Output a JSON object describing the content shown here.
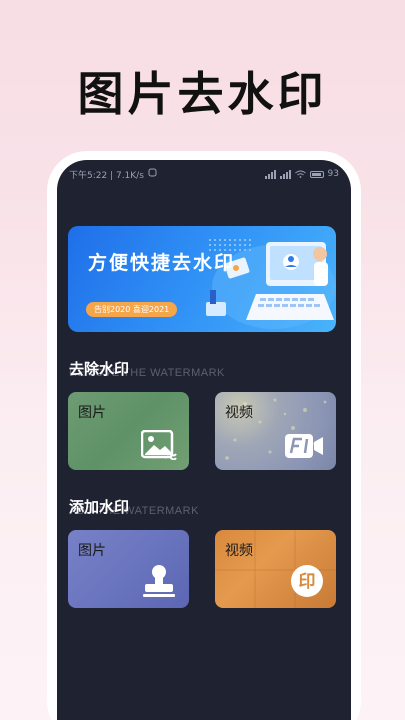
{
  "headline": "图片去水印",
  "status_bar": {
    "left": "下午5:22 | 7.1K/s",
    "battery": "93"
  },
  "banner": {
    "title": "方便快捷去水印",
    "tag": "告别2020 喜迎2021"
  },
  "sections": [
    {
      "title": "去除水印",
      "subtitle": "REMOVE THE WATERMARK",
      "tiles": [
        {
          "label": "图片",
          "icon": "image-icon"
        },
        {
          "label": "视频",
          "icon": "video-icon"
        }
      ]
    },
    {
      "title": "添加水印",
      "subtitle": "ADD THE WATERMARK",
      "tiles": [
        {
          "label": "图片",
          "icon": "stamp-icon"
        },
        {
          "label": "视频",
          "icon": "seal-icon",
          "icon_text": "印"
        }
      ]
    }
  ]
}
